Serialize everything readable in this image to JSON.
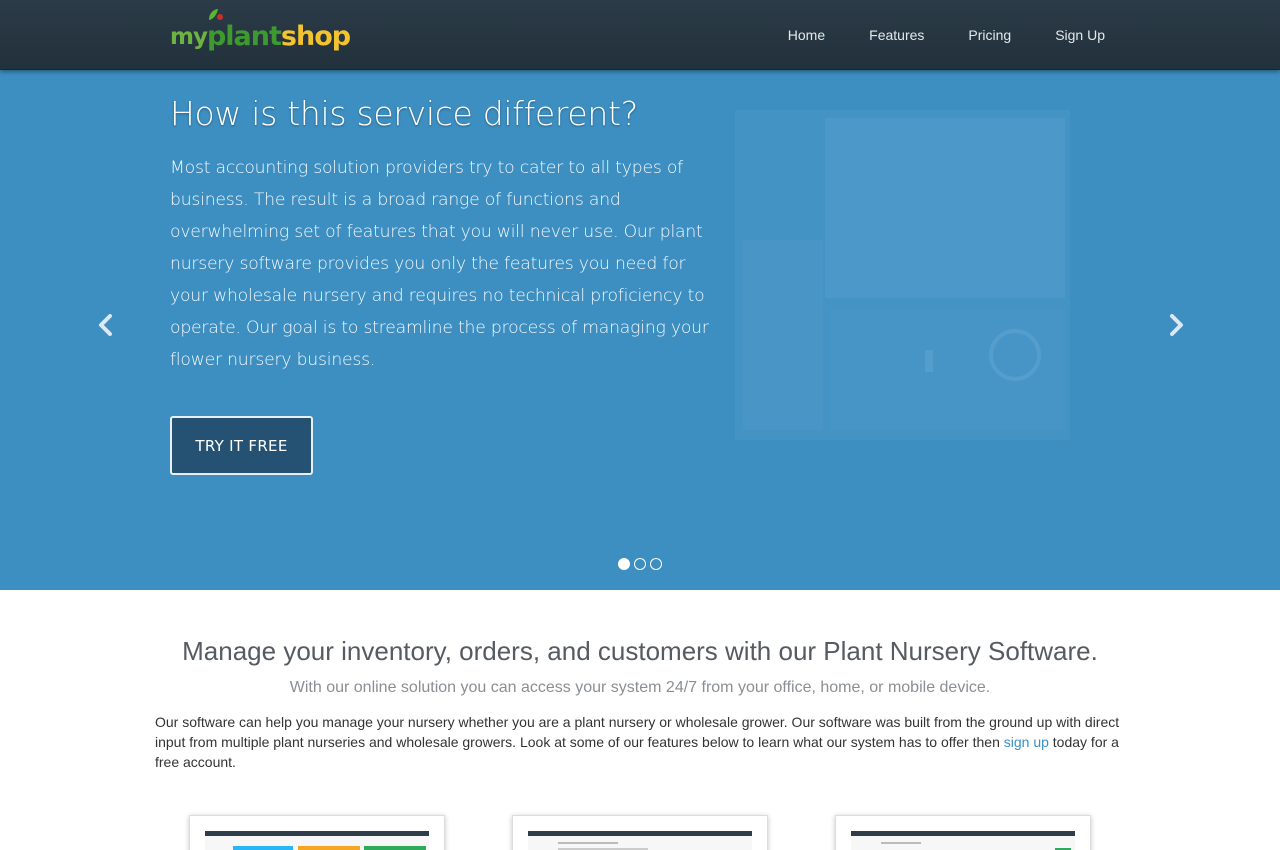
{
  "brand": {
    "part1": "my",
    "part2": "plant",
    "part3": "shop"
  },
  "nav": {
    "items": [
      {
        "label": "Home"
      },
      {
        "label": "Features"
      },
      {
        "label": "Pricing"
      },
      {
        "label": "Sign Up"
      }
    ]
  },
  "hero": {
    "title": "How is this service different?",
    "text": "Most accounting solution providers try to cater to all types of business. The result is a broad range of functions and overwhelming set of features that you will never use. Our plant nursery software provides you only the features you need for your wholesale nursery and requires no technical proficiency to operate. Our goal is to streamline the process of managing your flower nursery business.",
    "button_label": "TRY IT FREE",
    "slides": {
      "count": 3,
      "active": 1
    }
  },
  "content": {
    "heading": "Manage your inventory, orders, and customers with our Plant Nursery Software.",
    "subheading": "With our online solution you can access your system 24/7 from your office, home, or mobile device.",
    "body_before_link": "Our software can help you manage your nursery whether you are a plant nursery or wholesale grower. Our software was built from the ground up with direct input from multiple plant nurseries and wholesale growers. Look at some of our features below to learn what our system has to offer then ",
    "link_text": "sign up",
    "body_after_link": " today for a free account."
  },
  "colors": {
    "navbar": "#22313c",
    "hero_bg": "#3d8fc2",
    "button_bg": "#255272",
    "link": "#3a8fcb",
    "logo_green": "#3e9a2e",
    "logo_yellow": "#f4c430"
  },
  "icons": {
    "carousel_prev": "chevron-left-icon",
    "carousel_next": "chevron-right-icon"
  }
}
